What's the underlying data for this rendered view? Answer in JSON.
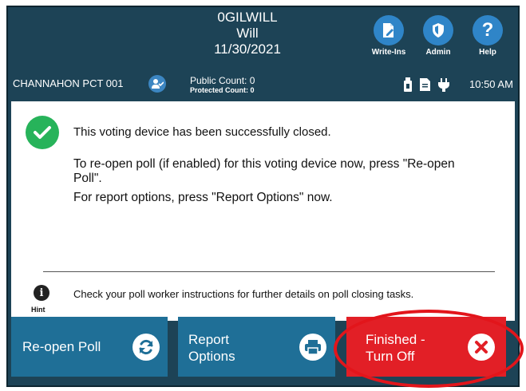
{
  "header": {
    "device_id": "0GILWILL",
    "county": "Will",
    "date": "11/30/2021",
    "precinct": "CHANNAHON PCT 001",
    "public_count": "Public Count: 0",
    "protected_count": "Protected Count: 0",
    "time": "10:50 AM",
    "toolbar": [
      {
        "label": "Write-Ins",
        "icon": "write-ins-icon"
      },
      {
        "label": "Admin",
        "icon": "shield-icon"
      },
      {
        "label": "Help",
        "icon": "help-icon"
      }
    ],
    "status_icons": [
      "usb-icon",
      "document-icon",
      "power-plug-icon"
    ]
  },
  "message": {
    "line1": "This voting device has been successfully closed.",
    "line2": "To re-open poll (if enabled) for this voting device now, press \"Re-open Poll\".",
    "line3": "For report options, press \"Report Options\" now."
  },
  "hint": {
    "label": "Hint",
    "text": "Check your poll worker instructions for further details on poll closing tasks."
  },
  "buttons": {
    "reopen": "Re-open Poll",
    "report_line1": "Report",
    "report_line2": "Options",
    "finished_line1": "Finished -",
    "finished_line2": "Turn Off"
  },
  "colors": {
    "header_bg": "#1d4356",
    "button_blue": "#1f6f97",
    "button_red": "#e21f26",
    "success_green": "#27b35a",
    "toolbar_circle": "#2f85c8"
  }
}
